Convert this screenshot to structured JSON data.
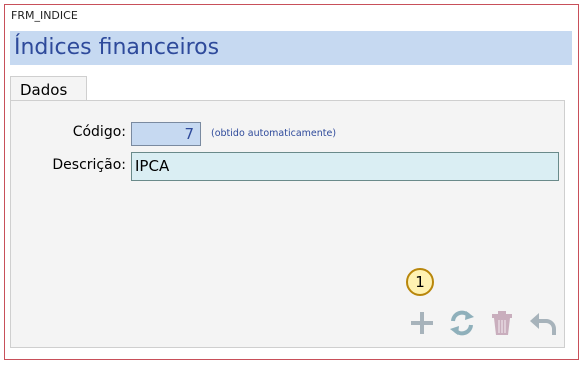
{
  "window": {
    "title": "FRM_INDICE"
  },
  "header": {
    "title": "Índices financeiros"
  },
  "tabs": [
    {
      "label": "Dados"
    }
  ],
  "form": {
    "codigo_label": "Código:",
    "codigo_value": "7",
    "codigo_hint": "(obtido automaticamente)",
    "descricao_label": "Descrição:",
    "descricao_value": "IPCA"
  },
  "callout": {
    "number": "1"
  },
  "toolbar": {
    "icons": [
      "add-icon",
      "refresh-icon",
      "delete-icon",
      "undo-icon"
    ]
  },
  "colors": {
    "accent": "#2e4a9b",
    "header_bg": "#c6d9f1",
    "field_bg": "#daeef3",
    "border": "#c8505a"
  }
}
